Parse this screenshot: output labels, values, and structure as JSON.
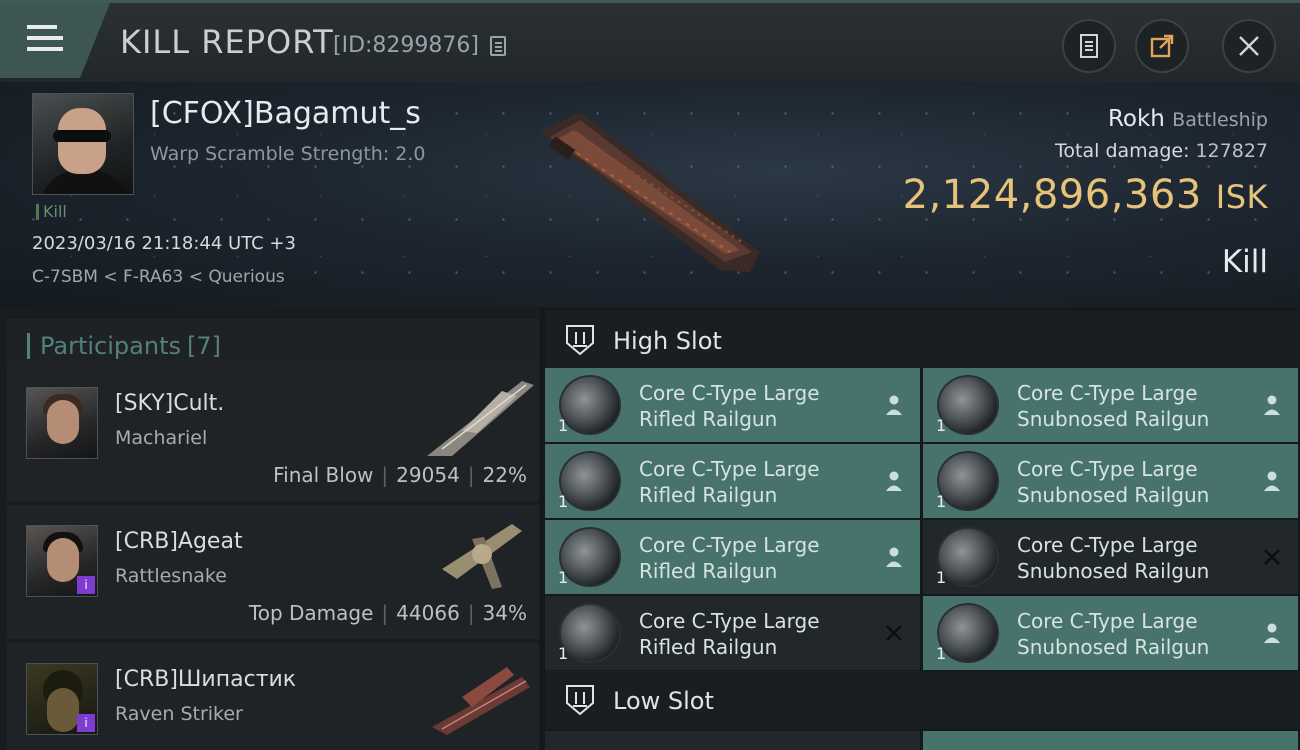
{
  "window": {
    "title": "KILL REPORT",
    "report_id": "[ID:8299876]"
  },
  "victim": {
    "name": "[CFOX]Bagamut_s",
    "scram": "Warp Scramble Strength: 2.0",
    "kill_tag": "Kill",
    "datetime": "2023/03/16 21:18:44 UTC +3",
    "location": "C-7SBM < F-RA63 < Querious",
    "ship": "Rokh",
    "ship_class": "Battleship",
    "total_damage_label": "Total damage:",
    "total_damage": "127827",
    "isk_value": "2,124,896,363",
    "isk_unit": "ISK",
    "result": "Kill"
  },
  "participants": {
    "title": "Participants",
    "count": "[7]",
    "rows": [
      {
        "name": "[SKY]Cult.",
        "ship": "Machariel",
        "role": "Final Blow",
        "damage": "29054",
        "percent": "22%",
        "badge": ""
      },
      {
        "name": "[CRB]Ageat",
        "ship": "Rattlesnake",
        "role": "Top Damage",
        "damage": "44066",
        "percent": "34%",
        "badge": "i"
      },
      {
        "name": "[CRB]Шипастик",
        "ship": "Raven Striker",
        "role": "",
        "damage": "",
        "percent": "",
        "badge": "i"
      }
    ]
  },
  "slots": {
    "high_label": "High Slot",
    "low_label": "Low Slot",
    "high_modules": [
      {
        "line1": "Core C-Type Large",
        "line2": "Rifled Railgun",
        "qty": "1",
        "status": "dropped"
      },
      {
        "line1": "Core C-Type Large",
        "line2": "Snubnosed Railgun",
        "qty": "1",
        "status": "dropped"
      },
      {
        "line1": "Core C-Type Large",
        "line2": "Rifled Railgun",
        "qty": "1",
        "status": "dropped"
      },
      {
        "line1": "Core C-Type Large",
        "line2": "Snubnosed Railgun",
        "qty": "1",
        "status": "dropped"
      },
      {
        "line1": "Core C-Type Large",
        "line2": "Rifled Railgun",
        "qty": "1",
        "status": "dropped"
      },
      {
        "line1": "Core C-Type Large",
        "line2": "Snubnosed Railgun",
        "qty": "1",
        "status": "destroyed"
      },
      {
        "line1": "Core C-Type Large",
        "line2": "Rifled Railgun",
        "qty": "1",
        "status": "destroyed"
      },
      {
        "line1": "Core C-Type Large",
        "line2": "Snubnosed Railgun",
        "qty": "1",
        "status": "dropped"
      }
    ]
  },
  "colors": {
    "accent": "#48736d",
    "isk": "#e7c27a",
    "badge": "#7d3bd1"
  },
  "icons": [
    "menu-icon",
    "copy-icon",
    "clipboard-icon",
    "share-icon",
    "close-icon",
    "shield-icon",
    "person-icon",
    "x-icon"
  ]
}
